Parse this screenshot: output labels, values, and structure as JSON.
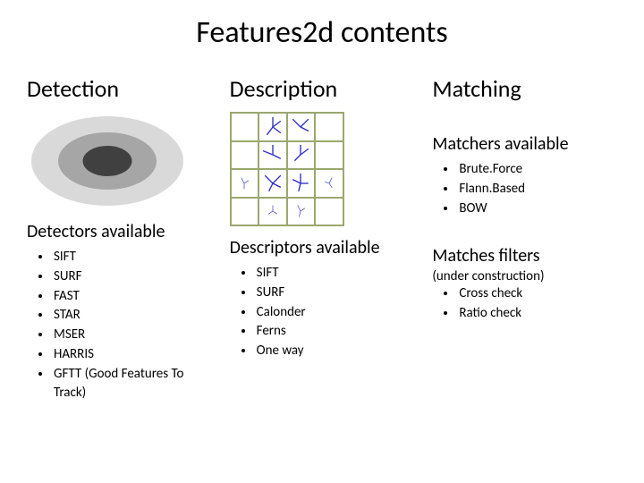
{
  "title": "Features2d contents",
  "columns": {
    "detection": {
      "heading": "Detection",
      "subheading": "Detectors available",
      "items": [
        "SIFT",
        "SURF",
        "FAST",
        "STAR",
        "MSER",
        "HARRIS",
        "GFTT (Good Features To Track)"
      ]
    },
    "description": {
      "heading": "Description",
      "subheading": "Descriptors available",
      "items": [
        "SIFT",
        "SURF",
        "Calonder",
        "Ferns",
        "One way"
      ]
    },
    "matching": {
      "heading": "Matching",
      "matchers_heading": "Matchers available",
      "matchers_items": [
        "Brute.Force",
        "Flann.Based",
        "BOW"
      ],
      "filters_heading": "Matches filters",
      "filters_note": "(under construction)",
      "filters_items": [
        "Cross check",
        "Ratio check"
      ]
    }
  }
}
